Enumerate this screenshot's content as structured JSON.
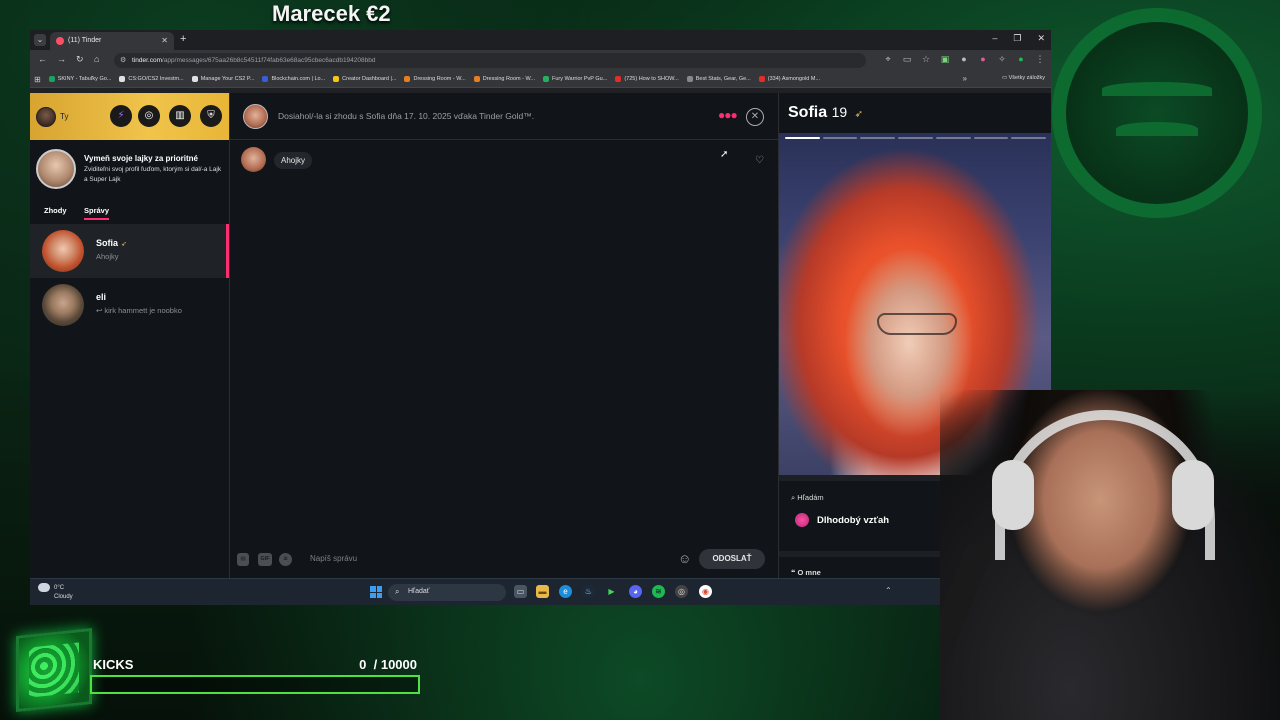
{
  "stream": {
    "title": "Marecek €2"
  },
  "browser": {
    "tab": {
      "title": "(11) Tinder"
    },
    "url": {
      "host": "tinder.com",
      "path": "/app/messages/675aa26b8c54511f74fab63e68ac95cbec6acdb194208bbd"
    },
    "bookmarks": [
      {
        "label": "SKINY - Tabuľky Go...",
        "color": "#1aa260"
      },
      {
        "label": "CS:GO/CS2 Investm...",
        "color": "#e0e0e0"
      },
      {
        "label": "Manage Your CS2 P...",
        "color": "#e0e0e0"
      },
      {
        "label": "Blockchain.com | Lo...",
        "color": "#3b5bdb"
      },
      {
        "label": "Creator Dashboard |...",
        "color": "#f5c518"
      },
      {
        "label": "Dressing Room - W...",
        "color": "#e67e22"
      },
      {
        "label": "Dressing Room - W...",
        "color": "#e67e22"
      },
      {
        "label": "Fury Warrior PvP Gu...",
        "color": "#27ae60"
      },
      {
        "label": "(725) How to SHOW...",
        "color": "#e52d27"
      },
      {
        "label": "Best Stats, Gear, Ge...",
        "color": "#888888"
      },
      {
        "label": "(334) Asmongold M...",
        "color": "#e52d27"
      }
    ],
    "all_bookmarks": "Všetky záložky"
  },
  "sidebar": {
    "me_label": "Ty",
    "promo": {
      "title": "Vymeň svoje lajky za prioritné",
      "text": "Zviditeľni svoj profil ľuďom, ktorým si dal/-a Lajk a Super Lajk"
    },
    "tabs": {
      "matches": "Zhody",
      "messages": "Správy"
    },
    "conversations": [
      {
        "name": "Sofia",
        "last": "Ahojky",
        "gold": true
      },
      {
        "name": "eli",
        "last": "↩ kirk hammett je noobko",
        "gold": false
      }
    ]
  },
  "chat": {
    "match_text": "Dosiahol/-la si zhodu s Sofia dňa 17. 10. 2025 vďaka Tinder Gold™.",
    "messages": [
      {
        "text": "Ahojky"
      }
    ],
    "compose": {
      "placeholder": "Napíš správu",
      "send": "ODOSLAŤ",
      "gif": "GIF"
    }
  },
  "profile": {
    "name": "Sofia",
    "age": "19",
    "looking_label": "Hľadám",
    "looking_value": "Dlhodobý vzťah",
    "about_label": "O mne"
  },
  "taskbar": {
    "weather_temp": "0°C",
    "weather_desc": "Cloudy",
    "search": "Hľadať"
  },
  "kicks": {
    "label": "KICKS",
    "current": "0",
    "goal": "/ 10000",
    "progress": 0
  },
  "colors": {
    "accent": "#fd2e6f",
    "gold": "#f0c44a",
    "kicks_green": "#4fe043"
  }
}
